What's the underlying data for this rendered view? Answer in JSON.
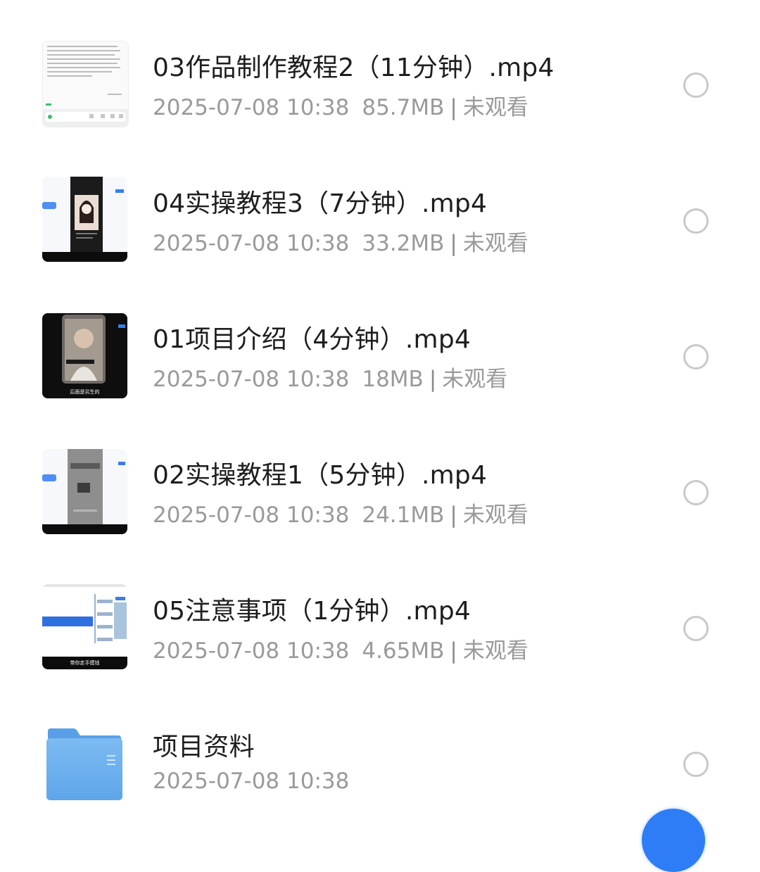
{
  "files": [
    {
      "title": "03作品制作教程2（11分钟）.mp4",
      "date": "2025-07-08 10:38",
      "size": "85.7MB",
      "status": "未观看",
      "thumb_icon": "video-thumbnail-text-icon"
    },
    {
      "title": "04实操教程3（7分钟）.mp4",
      "date": "2025-07-08 10:38",
      "size": "33.2MB",
      "status": "未观看",
      "thumb_icon": "video-thumbnail-phone-icon"
    },
    {
      "title": "01项目介绍（4分钟）.mp4",
      "date": "2025-07-08 10:38",
      "size": "18MB",
      "status": "未观看",
      "thumb_icon": "video-thumbnail-person-icon",
      "thumb_caption": "后面是另生的"
    },
    {
      "title": "02实操教程1（5分钟）.mp4",
      "date": "2025-07-08 10:38",
      "size": "24.1MB",
      "status": "未观看",
      "thumb_icon": "video-thumbnail-phone-icon"
    },
    {
      "title": "05注意事项（1分钟）.mp4",
      "date": "2025-07-08 10:38",
      "size": "4.65MB",
      "status": "未观看",
      "thumb_icon": "video-thumbnail-screen-icon",
      "thumb_caption": "带你走手摸钱"
    },
    {
      "title": "项目资料",
      "date": "2025-07-08 10:38",
      "thumb_icon": "folder-icon"
    }
  ],
  "colors": {
    "accent": "#2e7cf6",
    "folder": "#6fb1ee",
    "title_text": "#1e1e1e",
    "meta_text": "#9a9a9a",
    "radio_border": "#c9c9c9"
  }
}
